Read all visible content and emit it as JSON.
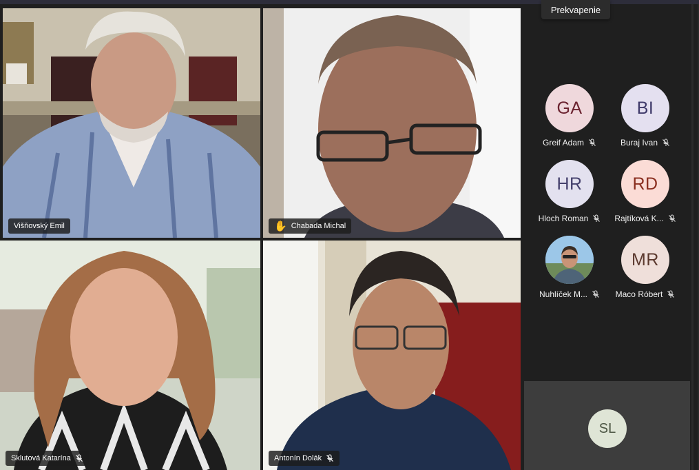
{
  "tooltip": "Prekvapenie",
  "tiles": [
    {
      "name": "Višňovský Emil",
      "muted": false,
      "hand_raised": false,
      "active": true
    },
    {
      "name": "Chabada Michal",
      "muted": false,
      "hand_raised": true,
      "active": true
    },
    {
      "name": "Sklutová Katarína",
      "muted": true,
      "hand_raised": false,
      "active": false
    },
    {
      "name": "Antonín Dolák",
      "muted": true,
      "hand_raised": false,
      "active": false
    }
  ],
  "roster": [
    {
      "initials": "GA",
      "name": "Greif Adam",
      "muted": true,
      "bg": "#efd8dc",
      "fg": "#6b2330"
    },
    {
      "initials": "BI",
      "name": "Buraj Ivan",
      "muted": true,
      "bg": "#e4e0f0",
      "fg": "#3f3a6a"
    },
    {
      "initials": "HR",
      "name": "Hloch Roman",
      "muted": true,
      "bg": "#e3e1ef",
      "fg": "#45416d"
    },
    {
      "initials": "RD",
      "name": "Rajtíková K...",
      "muted": true,
      "bg": "#fbdcd6",
      "fg": "#8a2e1f"
    },
    {
      "initials": "",
      "name": "Nuhlíček M...",
      "muted": true,
      "bg": "#5b8aa8",
      "fg": "#ffffff",
      "photo": true
    },
    {
      "initials": "MR",
      "name": "Maco Róbert",
      "muted": true,
      "bg": "#efdfda",
      "fg": "#5c3a2f"
    }
  ],
  "self": {
    "initials": "SL"
  }
}
